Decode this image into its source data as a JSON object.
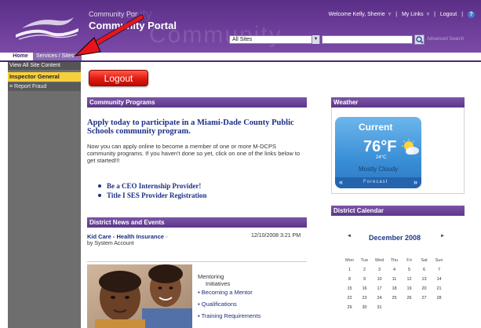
{
  "header": {
    "supertitle": "Community Por",
    "title": "Community Portal",
    "watermark": "Community",
    "watermark_top": "unity",
    "scope_select": {
      "value": "All Sites"
    },
    "search": {
      "value": "",
      "placeholder": ""
    },
    "advanced_search": "Advanced Search",
    "welcome": "Welcome Kelly, Sherrie",
    "my_links": "My Links",
    "logout_link": "Logout",
    "help": "?"
  },
  "tabs": [
    {
      "label": "Home",
      "active": true
    },
    {
      "label": "Services / Sites",
      "active": false
    }
  ],
  "left_nav": {
    "view_all": "View All Site Content",
    "items": [
      {
        "label": "Inspector General",
        "selected": true
      },
      {
        "label": "Report Fraud",
        "selected": false
      }
    ],
    "report_prefix": "≡"
  },
  "logout_button": "Logout",
  "community_programs": {
    "header": "Community Programs",
    "heading": "Apply today to participate in a Miami-Dade County Public Schools community program.",
    "text": "Now you can apply online to become a member of one or more M-DCPS community programs.  If you haven't done so yet, click on one of the links below to get started!!!",
    "links": [
      "Be a CEO Internship Provider!",
      "Title I SES Provider Registration"
    ]
  },
  "district_news": {
    "header": "District News and Events",
    "item": {
      "title": "Kid Care - Health Insurance",
      "by": "by System Account",
      "date": "12/10/2008 3:21 PM"
    },
    "mentoring_title_1": "Mentoring",
    "mentoring_title_2": "Initiatives",
    "mentoring_links": [
      "Becoming a Mentor",
      "Qualifications",
      "Training Requirements"
    ]
  },
  "weather": {
    "header": "Weather",
    "current_label": "Current",
    "temp_f": "76°F",
    "temp_c": "24°C",
    "condition": "Mostly Cloudy",
    "forecast_label": "Forecast",
    "prev": "«",
    "next": "»",
    "icon": "partly-cloudy-icon"
  },
  "calendar": {
    "header": "District Calendar",
    "month": "December 2008",
    "prev": "◄",
    "next": "►",
    "days_of_week": [
      "Mon",
      "Tue",
      "Wed",
      "Thu",
      "Fri",
      "Sat",
      "Sun"
    ],
    "weeks": [
      [
        "1",
        "2",
        "3",
        "4",
        "5",
        "6",
        "7"
      ],
      [
        "8",
        "9",
        "10",
        "11",
        "12",
        "13",
        "14"
      ],
      [
        "15",
        "16",
        "17",
        "18",
        "19",
        "20",
        "21"
      ],
      [
        "22",
        "23",
        "24",
        "25",
        "26",
        "27",
        "28"
      ],
      [
        "29",
        "30",
        "31",
        "",
        "",
        "",
        ""
      ]
    ]
  },
  "colors": {
    "header_purple": "#6b3c98",
    "nav_gray": "#6e6e6e",
    "selected_yellow": "#f6cf3c",
    "link_blue": "#1e2f86",
    "logout_red": "#e01a10",
    "annotation_arrow": "#e8141c"
  }
}
